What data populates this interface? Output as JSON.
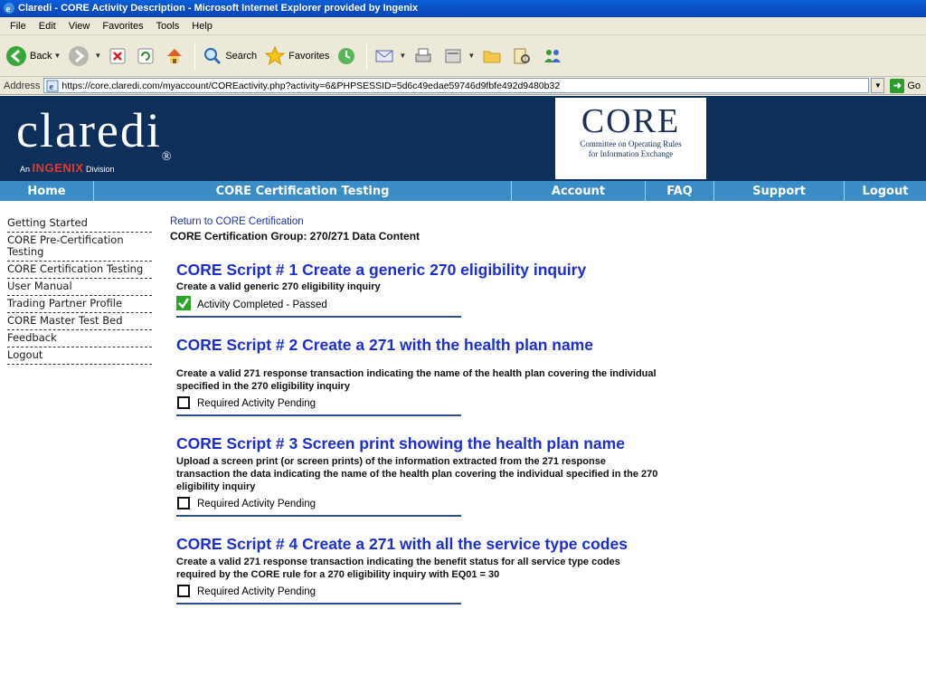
{
  "browser": {
    "title": "Claredi - CORE Activity Description - Microsoft Internet Explorer provided by Ingenix",
    "menu": [
      "File",
      "Edit",
      "View",
      "Favorites",
      "Tools",
      "Help"
    ],
    "toolbar": {
      "back": "Back",
      "search": "Search",
      "favorites": "Favorites"
    },
    "address_label": "Address",
    "address_url": "https://core.claredi.com/myaccount/COREactivity.php?activity=6&PHPSESSID=5d6c49edae59746d9fbfe492d9480b32",
    "go_label": "Go"
  },
  "site": {
    "logo_text": "claredi",
    "logo_reg": "®",
    "logo_sub_prefix": "An",
    "logo_sub_brand": "INGENIX",
    "logo_sub_suffix": "Division",
    "core_logo_word": "CORE",
    "core_logo_sub1": "Committee on Operating Rules",
    "core_logo_sub2": "for Information Exchange"
  },
  "nav": [
    "Home",
    "CORE Certification Testing",
    "Account",
    "FAQ",
    "Support",
    "Logout"
  ],
  "sidebar": [
    "Getting Started",
    "CORE Pre-Certification Testing",
    "CORE Certification Testing",
    "User Manual",
    "Trading Partner Profile",
    "CORE Master Test Bed",
    "Feedback",
    "Logout"
  ],
  "main": {
    "return_link": "Return to CORE Certification",
    "group_title": "CORE Certification Group:  270/271 Data Content",
    "scripts": [
      {
        "title": "CORE Script # 1 Create a generic 270 eligibility inquiry",
        "description": "Create a valid generic 270 eligibility inquiry",
        "status": "Activity Completed - Passed"
      },
      {
        "title": "CORE Script # 2 Create a 271 with the health plan name",
        "description": "Create a valid 271 response transaction indicating the name of the health plan covering the individual specified in the 270 eligibility inquiry",
        "status": "Required Activity Pending"
      },
      {
        "title": "CORE Script # 3 Screen print showing the health plan name",
        "description": "Upload a screen print (or screen prints) of the information extracted from the 271 response transaction the data indicating the name of the health plan covering the individual specified in the 270 eligibility inquiry",
        "status": "Required Activity Pending"
      },
      {
        "title": "CORE Script # 4 Create a 271 with all the service type codes",
        "description": "Create a valid 271 response transaction indicating the benefit status for all service type codes required by the CORE rule for a 270 eligibility inquiry with EQ01 = 30",
        "status": "Required Activity Pending"
      }
    ]
  }
}
